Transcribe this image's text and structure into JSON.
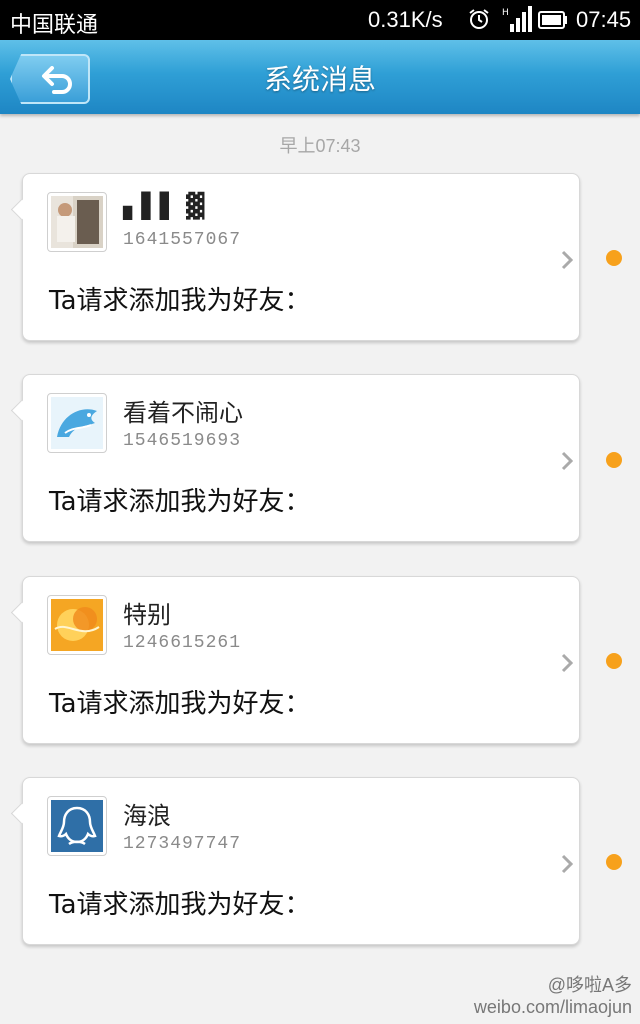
{
  "status_bar": {
    "carrier": "中国联通",
    "network_speed": "0.31K/s",
    "time": "07:45",
    "icons": [
      "alarm-icon",
      "signal-icon",
      "battery-icon"
    ]
  },
  "header": {
    "title": "系统消息",
    "back_icon": "back-arrow-icon"
  },
  "timestamp": "早上07:43",
  "messages": [
    {
      "name": "▖▌▌ ▓",
      "uid": "1641557067",
      "text": "Ta请求添加我为好友：",
      "avatar": "photo-avatar"
    },
    {
      "name": "看着不闹心",
      "uid": "1546519693",
      "text": "Ta请求添加我为好友：",
      "avatar": "dolphin-avatar"
    },
    {
      "name": "特别",
      "uid": "1246615261",
      "text": "Ta请求添加我为好友：",
      "avatar": "orange-abstract-avatar"
    },
    {
      "name": "海浪",
      "uid": "1273497747",
      "text": "Ta请求添加我为好友：",
      "avatar": "qq-penguin-avatar"
    }
  ],
  "colors": {
    "header_blue": "#2f9fd6",
    "unread_dot": "#f7a11c",
    "background": "#f2f2f2"
  },
  "watermark": {
    "line1": "@哆啦A多",
    "line2": "weibo.com/limaojun"
  }
}
